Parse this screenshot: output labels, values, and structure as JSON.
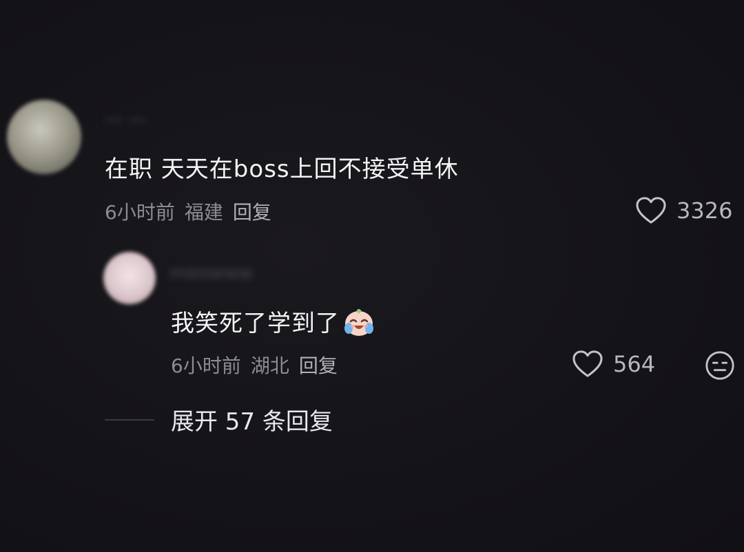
{
  "comment_1": {
    "username": "一 一",
    "text": "在职 天天在boss上回不接受单休",
    "time": "6小时前",
    "location": "福建",
    "reply_label": "回复",
    "likes": "3326",
    "like_icon": "heart-outline-icon"
  },
  "comment_2": {
    "username": "meowww",
    "text": "我笑死了学到了",
    "emoji": "crying-laughing-baby-emoji",
    "time": "6小时前",
    "location": "湖北",
    "reply_label": "回复",
    "likes": "564",
    "like_icon": "heart-outline-icon",
    "dislike_icon": "expressionless-face-icon"
  },
  "expand_replies": {
    "label": "展开 57 条回复"
  },
  "colors": {
    "background": "#151419",
    "text_primary": "#f4f4f6",
    "text_secondary": "#8d8c94"
  }
}
